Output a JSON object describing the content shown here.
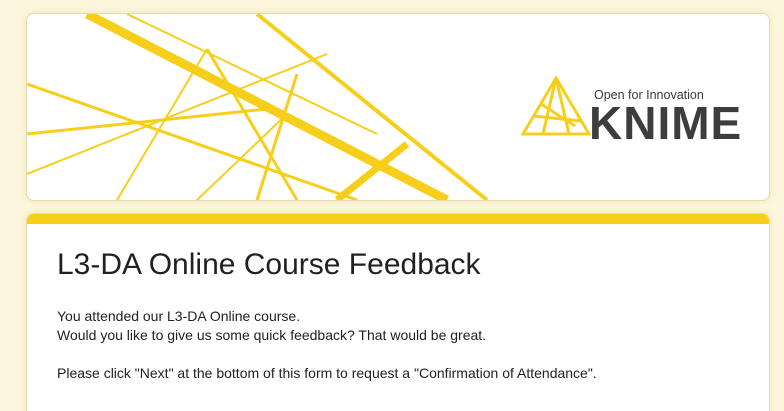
{
  "header": {
    "logo": {
      "tagline": "Open for Innovation",
      "wordmark": "KNIME",
      "icon": "knime-triangle-logo",
      "accent_color": "#f7cf1b"
    }
  },
  "form": {
    "title": "L3-DA Online Course Feedback",
    "description": {
      "line1": "You attended our L3-DA Online course.",
      "line2": "Would you like to give us some quick feedback? That would be great.",
      "line3": "Please click \"Next\" at the bottom of this form to request a \"Confirmation of Attendance\"."
    }
  },
  "colors": {
    "background": "#fdf6dc",
    "accent": "#f7cf1b",
    "text": "#202124"
  }
}
